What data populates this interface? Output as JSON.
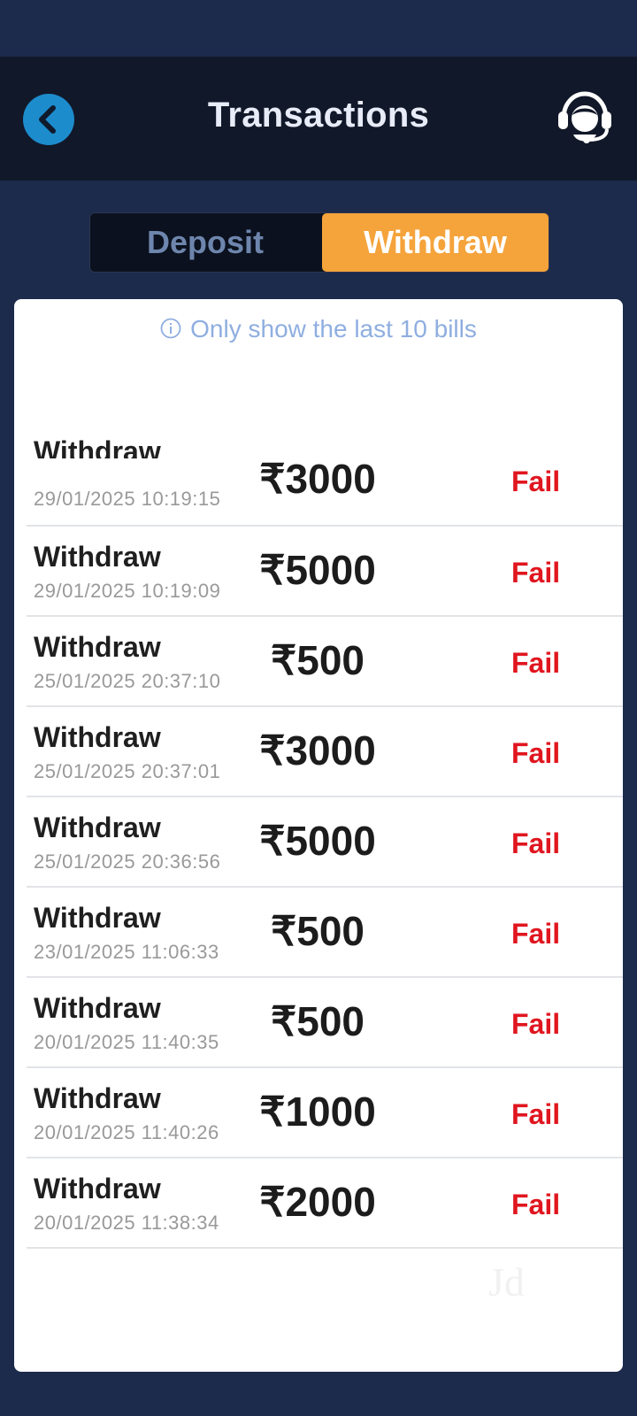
{
  "header": {
    "title": "Transactions",
    "back_icon": "chevron-left-icon",
    "support_icon": "headset-support-icon"
  },
  "tabs": {
    "deposit_label": "Deposit",
    "withdraw_label": "Withdraw",
    "active": "Withdraw"
  },
  "notice": {
    "icon": "info-icon",
    "text": "Only show the last 10 bills"
  },
  "transactions": [
    {
      "type": "Withdraw",
      "date": "29/01/2025 10:19:15",
      "amount": "₹3000",
      "status": "Fail"
    },
    {
      "type": "Withdraw",
      "date": "29/01/2025 10:19:09",
      "amount": "₹5000",
      "status": "Fail"
    },
    {
      "type": "Withdraw",
      "date": "25/01/2025 20:37:10",
      "amount": "₹500",
      "status": "Fail"
    },
    {
      "type": "Withdraw",
      "date": "25/01/2025 20:37:01",
      "amount": "₹3000",
      "status": "Fail"
    },
    {
      "type": "Withdraw",
      "date": "25/01/2025 20:36:56",
      "amount": "₹5000",
      "status": "Fail"
    },
    {
      "type": "Withdraw",
      "date": "23/01/2025 11:06:33",
      "amount": "₹500",
      "status": "Fail"
    },
    {
      "type": "Withdraw",
      "date": "20/01/2025 11:40:35",
      "amount": "₹500",
      "status": "Fail"
    },
    {
      "type": "Withdraw",
      "date": "20/01/2025 11:40:26",
      "amount": "₹1000",
      "status": "Fail"
    },
    {
      "type": "Withdraw",
      "date": "20/01/2025 11:38:34",
      "amount": "₹2000",
      "status": "Fail"
    }
  ],
  "watermark": "Jd",
  "colors": {
    "background": "#1c2a4b",
    "header": "#111829",
    "accent": "#f5a33b",
    "back_button": "#1d8ccd",
    "fail": "#e0161f"
  }
}
